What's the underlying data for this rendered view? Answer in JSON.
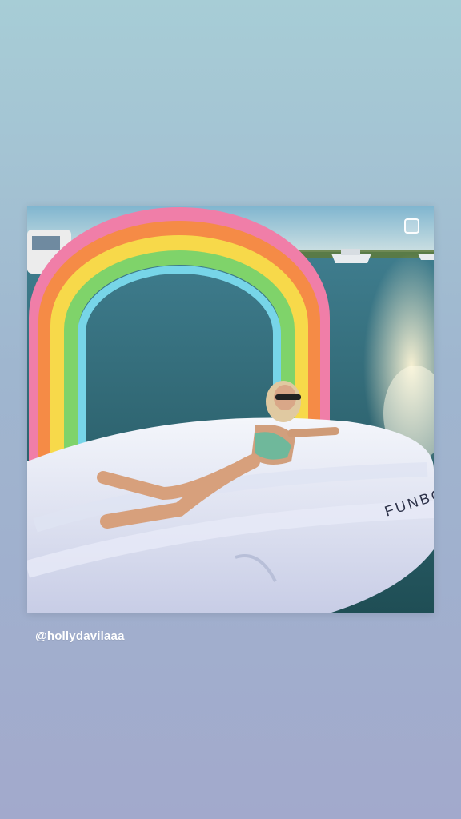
{
  "post": {
    "mention": "@hollydavilaaa",
    "photo_text": "FUNBO"
  },
  "icons": [
    "select-checkbox-icon"
  ]
}
